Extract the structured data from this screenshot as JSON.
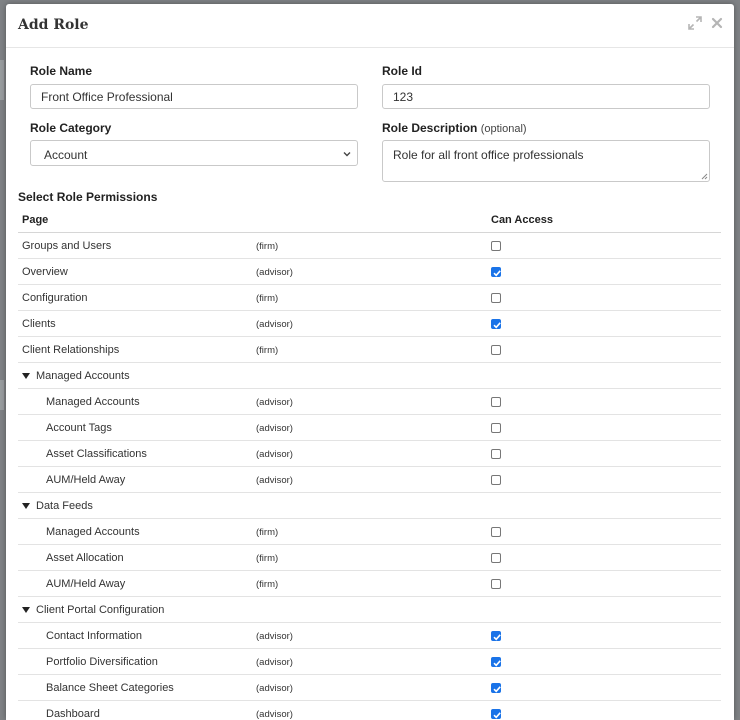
{
  "modal": {
    "title": "Add Role"
  },
  "form": {
    "role_name": {
      "label": "Role Name",
      "value": "Front Office Professional"
    },
    "role_id": {
      "label": "Role Id",
      "value": "123"
    },
    "role_category": {
      "label": "Role Category",
      "value": "Account"
    },
    "role_description": {
      "label": "Role Description",
      "optional": "(optional)",
      "value": "Role for all front office professionals"
    }
  },
  "permissions": {
    "title": "Select Role Permissions",
    "columns": {
      "page": "Page",
      "access": "Can Access"
    },
    "rows": [
      {
        "type": "top",
        "name": "Groups and Users",
        "scope": "(firm)",
        "checked": false
      },
      {
        "type": "top",
        "name": "Overview",
        "scope": "(advisor)",
        "checked": true
      },
      {
        "type": "top",
        "name": "Configuration",
        "scope": "(firm)",
        "checked": false
      },
      {
        "type": "top",
        "name": "Clients",
        "scope": "(advisor)",
        "checked": true
      },
      {
        "type": "top",
        "name": "Client Relationships",
        "scope": "(firm)",
        "checked": false
      },
      {
        "type": "group",
        "name": "Managed Accounts"
      },
      {
        "type": "child",
        "name": "Managed Accounts",
        "scope": "(advisor)",
        "checked": false
      },
      {
        "type": "child",
        "name": "Account Tags",
        "scope": "(advisor)",
        "checked": false
      },
      {
        "type": "child",
        "name": "Asset Classifications",
        "scope": "(advisor)",
        "checked": false
      },
      {
        "type": "child",
        "name": "AUM/Held Away",
        "scope": "(advisor)",
        "checked": false
      },
      {
        "type": "group",
        "name": "Data Feeds"
      },
      {
        "type": "child",
        "name": "Managed Accounts",
        "scope": "(firm)",
        "checked": false
      },
      {
        "type": "child",
        "name": "Asset Allocation",
        "scope": "(firm)",
        "checked": false
      },
      {
        "type": "child",
        "name": "AUM/Held Away",
        "scope": "(firm)",
        "checked": false
      },
      {
        "type": "group",
        "name": "Client Portal Configuration"
      },
      {
        "type": "child",
        "name": "Contact Information",
        "scope": "(advisor)",
        "checked": true
      },
      {
        "type": "child",
        "name": "Portfolio Diversification",
        "scope": "(advisor)",
        "checked": true
      },
      {
        "type": "child",
        "name": "Balance Sheet Categories",
        "scope": "(advisor)",
        "checked": true
      },
      {
        "type": "child",
        "name": "Dashboard",
        "scope": "(advisor)",
        "checked": true
      }
    ]
  },
  "colors": {
    "accent": "#1a73e8",
    "border": "#c9c9c9"
  },
  "icons": {
    "expand": "expand-icon",
    "close": "close-icon",
    "caret": "chevron-down-icon",
    "group": "caret-down-icon"
  }
}
